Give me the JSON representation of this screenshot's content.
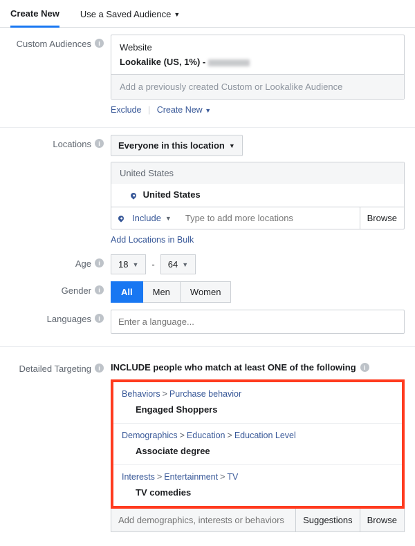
{
  "tabs": {
    "create_new": "Create New",
    "saved": "Use a Saved Audience"
  },
  "custom_audiences": {
    "label": "Custom Audiences",
    "website": "Website",
    "lookalike": "Lookalike (US, 1%) -",
    "placeholder": "Add a previously created Custom or Lookalike Audience",
    "exclude": "Exclude",
    "create_new": "Create New"
  },
  "locations": {
    "label": "Locations",
    "scope": "Everyone in this location",
    "group": "United States",
    "country": "United States",
    "include": "Include",
    "placeholder": "Type to add more locations",
    "browse": "Browse",
    "bulk": "Add Locations in Bulk"
  },
  "age": {
    "label": "Age",
    "min": "18",
    "max": "64",
    "dash": "-"
  },
  "gender": {
    "label": "Gender",
    "all": "All",
    "men": "Men",
    "women": "Women"
  },
  "languages": {
    "label": "Languages",
    "placeholder": "Enter a language..."
  },
  "detailed": {
    "label": "Detailed Targeting",
    "header": "INCLUDE people who match at least ONE of the following",
    "items": [
      {
        "path": [
          "Behaviors",
          "Purchase behavior"
        ],
        "value": "Engaged Shoppers"
      },
      {
        "path": [
          "Demographics",
          "Education",
          "Education Level"
        ],
        "value": "Associate degree"
      },
      {
        "path": [
          "Interests",
          "Entertainment",
          "TV"
        ],
        "value": "TV comedies"
      }
    ],
    "placeholder": "Add demographics, interests or behaviors",
    "suggestions": "Suggestions",
    "browse": "Browse"
  }
}
